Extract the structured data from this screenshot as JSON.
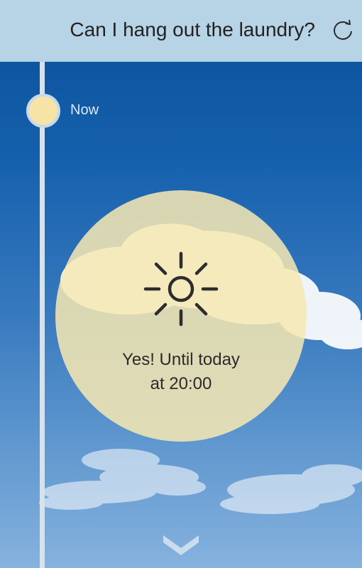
{
  "header": {
    "title": "Can I hang out the laundry?",
    "refresh_icon": "refresh-icon"
  },
  "timeline": {
    "current_label": "Now"
  },
  "forecast": {
    "icon": "sun-icon",
    "status_line1": "Yes! Until today",
    "status_line2": "at 20:00"
  },
  "navigation": {
    "scroll_icon": "chevron-down-icon"
  },
  "colors": {
    "header_bg": "#b7d3e6",
    "sky_top": "#0a4f98",
    "sky_bottom": "#86b2de",
    "bubble": "#f6e8b2",
    "dot": "#f5e4a6"
  }
}
